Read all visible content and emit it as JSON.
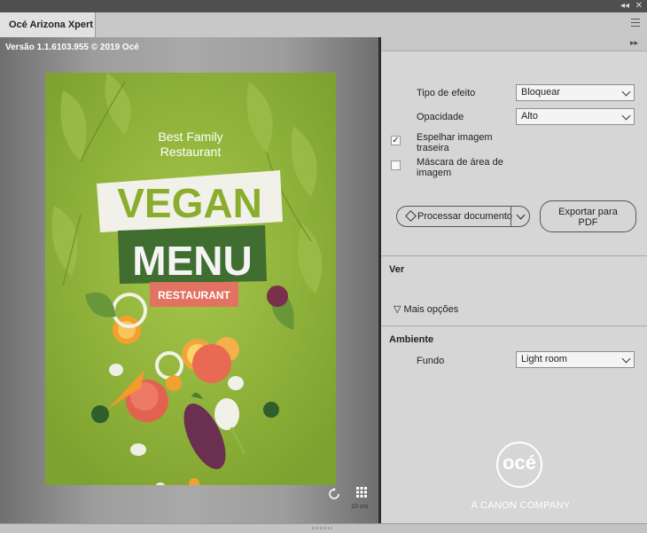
{
  "window": {
    "collapse_glyph": "◂◂",
    "close_glyph": "✕"
  },
  "tab": {
    "label": "Océ Arizona Xpert"
  },
  "preview": {
    "version_text": "Versão 1.1.6103.955 © 2019 Océ",
    "poster": {
      "line1": "Best Family",
      "line2": "Restaurant",
      "word1": "VEGAN",
      "word2": "MENU",
      "badge": "RESTAURANT"
    },
    "scale_label": "10 cm"
  },
  "settings": {
    "expand_glyph": "▸▸",
    "effect_type": {
      "label": "Tipo de efeito",
      "value": "Bloquear"
    },
    "opacity": {
      "label": "Opacidade",
      "value": "Alto"
    },
    "mirror": {
      "label_line1": "Espelhar imagem",
      "label_line2": "traseira",
      "checked": true
    },
    "mask": {
      "label_line1": "Máscara de área de",
      "label_line2": "imagem",
      "checked": false
    },
    "process_button": "Processar documento",
    "export_button_line1": "Exportar para",
    "export_button_line2": "PDF",
    "view_section": "Ver",
    "more_options": "Mais opções",
    "more_glyph": "▽",
    "ambient_section": "Ambiente",
    "background": {
      "label": "Fundo",
      "value": "Light room"
    }
  },
  "brand": {
    "logo_text": "océ",
    "tagline": "A CANON COMPANY"
  },
  "colors": {
    "poster_green": "#8db23a",
    "dark_green": "#3d6b2f",
    "salmon": "#e07060",
    "panel_gray": "#d6d6d6"
  }
}
